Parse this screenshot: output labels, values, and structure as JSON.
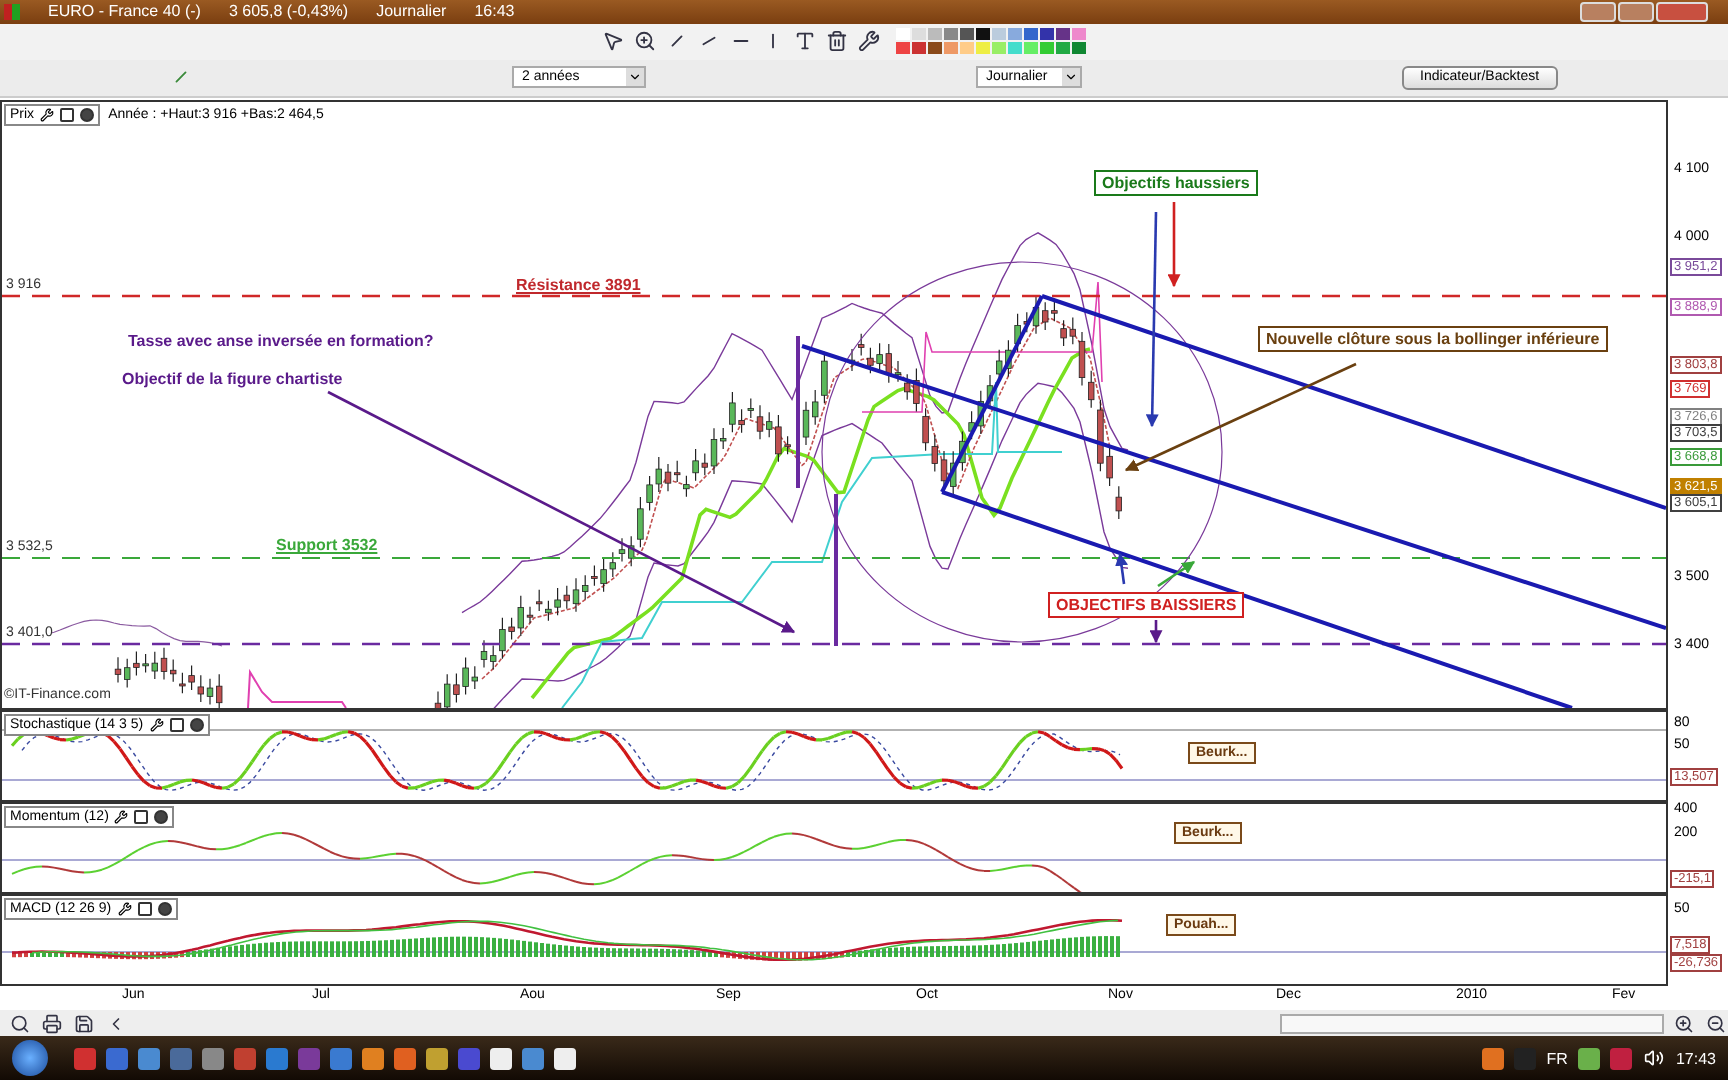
{
  "window": {
    "title_parts": [
      "EURO - France 40 (-)",
      "3 605,8 (-0,43%)",
      "Journalier",
      "16:43"
    ]
  },
  "toolbar": {
    "period_dropdown": "2 années",
    "interval_dropdown": "Journalier",
    "indicator_button": "Indicateur/Backtest"
  },
  "price_chart": {
    "title": "Prix",
    "info": "Année : +Haut:3 916 +Bas:2 464,5",
    "credit": "©IT-Finance.com",
    "level_labels": [
      "3 916",
      "3 532,5",
      "3 401,0"
    ],
    "axis_ticks": [
      "4 100",
      "4 000",
      "3 500",
      "3 400"
    ],
    "price_tags": [
      {
        "text": "3 951,2",
        "color": "#7a4a9a",
        "highlighted": false
      },
      {
        "text": "3 888,9",
        "color": "#b05ab0",
        "highlighted": false
      },
      {
        "text": "3 803,8",
        "color": "#a04040",
        "highlighted": false
      },
      {
        "text": "3 769",
        "color": "#d03030",
        "highlighted": false
      },
      {
        "text": "3 726,6",
        "color": "#808080",
        "highlighted": false
      },
      {
        "text": "3 703,5",
        "color": "#404040",
        "highlighted": false
      },
      {
        "text": "3 668,8",
        "color": "#3a9a3a",
        "highlighted": false
      },
      {
        "text": "3 621,5",
        "color": "#c08000",
        "highlighted": true
      },
      {
        "text": "3 605,1",
        "color": "#404040",
        "highlighted": false
      }
    ],
    "annotations": [
      {
        "text": "Résistance 3891",
        "kind": "underlined",
        "color": "#c0282c"
      },
      {
        "text": "Tasse avec anse inversée en formation?",
        "kind": "plain",
        "color": "#5a1a8a"
      },
      {
        "text": "Objectif de la figure chartiste",
        "kind": "plain",
        "color": "#5a1a8a"
      },
      {
        "text": "Support 3532",
        "kind": "underlined",
        "color": "#3aa83a"
      },
      {
        "text": "Objectifs haussiers",
        "kind": "boxed",
        "color": "#1a7a1a"
      },
      {
        "text": "Nouvelle clôture sous la bollinger inférieure",
        "kind": "boxed",
        "color": "#6a4010"
      },
      {
        "text": "OBJECTIFS BAISSIERS",
        "kind": "boxed",
        "color": "#d02020"
      }
    ]
  },
  "indicators": [
    {
      "kind": "stochastic",
      "title": "Stochastique (14 3 5)",
      "ticks": [
        "80",
        "50"
      ],
      "readings": [
        "13,507"
      ],
      "note": "Beurk..."
    },
    {
      "kind": "momentum",
      "title": "Momentum (12)",
      "ticks": [
        "400",
        "200"
      ],
      "readings": [
        "-215,1"
      ],
      "note": "Beurk..."
    },
    {
      "kind": "macd",
      "title": "MACD (12 26 9)",
      "ticks": [
        "50"
      ],
      "readings": [
        "7,518",
        "-26,736"
      ],
      "note": "Pouah..."
    }
  ],
  "months": [
    "Jun",
    "Jul",
    "Aou",
    "Sep",
    "Oct",
    "Nov",
    "Dec",
    "2010",
    "Fev"
  ],
  "taskbar": {
    "language": "FR",
    "clock": "17:43"
  }
}
